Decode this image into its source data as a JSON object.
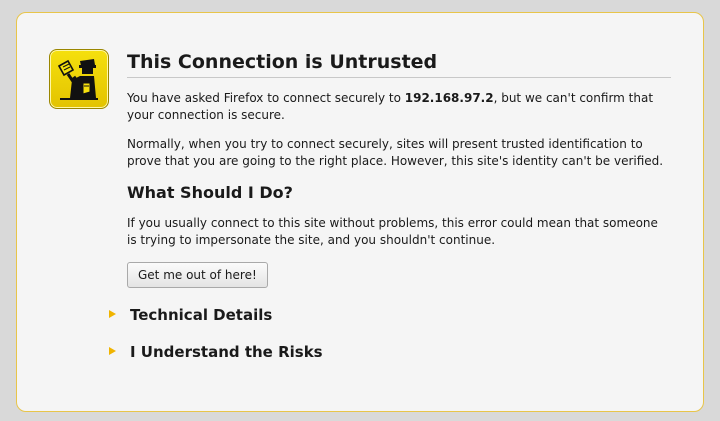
{
  "page": {
    "title": "This Connection is Untrusted",
    "intro_before": "You have asked Firefox to connect securely to ",
    "host": "192.168.97.2",
    "intro_after": ", but we can't confirm that your connection is secure.",
    "paragraph2": "Normally, when you try to connect securely, sites will present trusted identification to prove that you are going to the right place. However, this site's identity can't be verified.",
    "what_heading": "What Should I Do?",
    "paragraph3": "If you usually connect to this site without problems, this error could mean that someone is trying to impersonate the site, and you shouldn't continue.",
    "get_out_button": "Get me out of here!",
    "technical_details": "Technical Details",
    "understand_risks": "I Understand the Risks"
  },
  "colors": {
    "panel_border": "#e8c54a",
    "badge_yellow": "#f5e00e",
    "expander_arrow": "#f0b400"
  },
  "icons": {
    "badge": "untrusted-connection-officer-icon",
    "expander": "disclosure-triangle-icon"
  }
}
